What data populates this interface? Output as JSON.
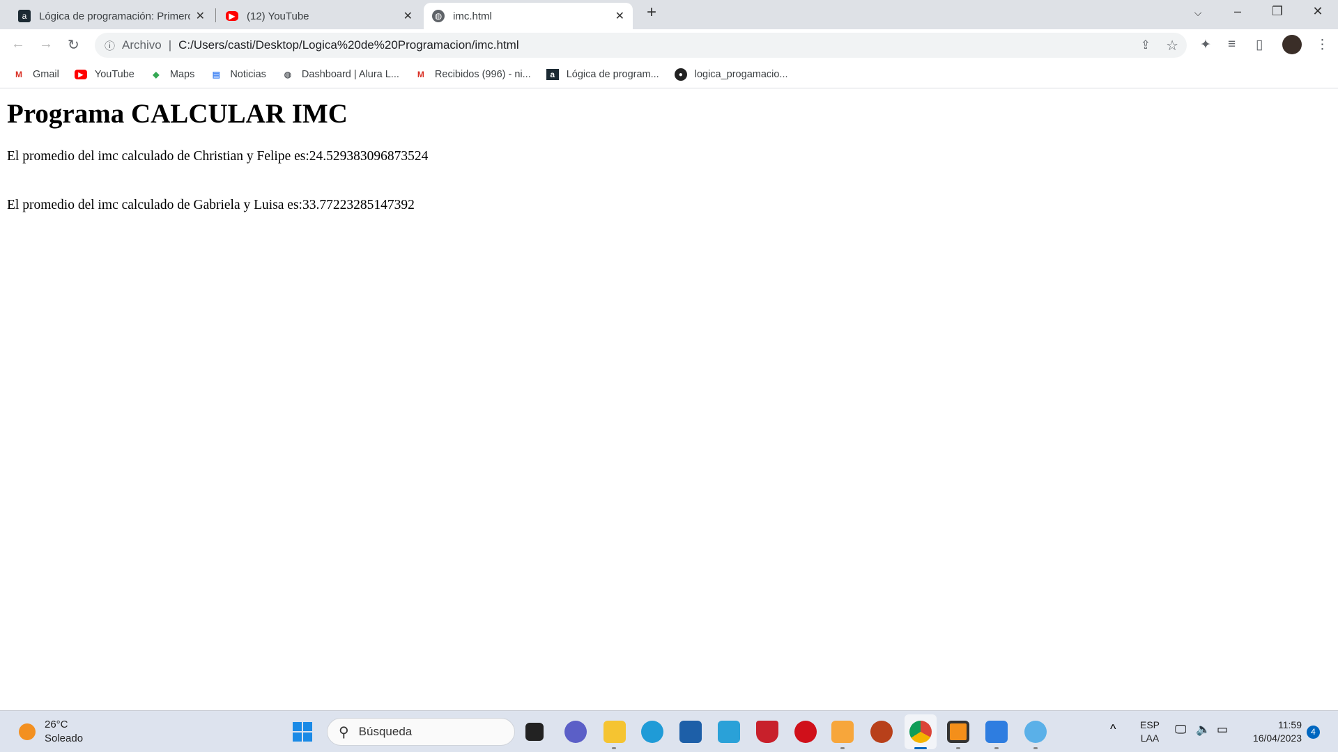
{
  "browser": {
    "tabs": [
      {
        "title": "Lógica de programación: Primeros pasos",
        "icon": "alura-icon",
        "active": false
      },
      {
        "title": "(12) YouTube",
        "icon": "youtube-icon",
        "active": false
      },
      {
        "title": "imc.html",
        "icon": "globe-icon",
        "active": true
      }
    ],
    "new_tab": "+",
    "address": {
      "scheme_label": "Archivo",
      "url": "C:/Users/casti/Desktop/Logica%20de%20Programacion/imc.html"
    },
    "bookmarks": [
      {
        "label": "Gmail",
        "icon": "gmail-icon"
      },
      {
        "label": "YouTube",
        "icon": "youtube-icon"
      },
      {
        "label": "Maps",
        "icon": "maps-icon"
      },
      {
        "label": "Noticias",
        "icon": "news-icon"
      },
      {
        "label": "Dashboard | Alura L...",
        "icon": "globe-icon"
      },
      {
        "label": "Recibidos (996) - ni...",
        "icon": "gmail-icon"
      },
      {
        "label": "Lógica de program...",
        "icon": "alura-icon"
      },
      {
        "label": "logica_progamacio...",
        "icon": "github-icon"
      }
    ]
  },
  "page": {
    "heading": "Programa CALCULAR IMC",
    "lines": [
      "El promedio del imc calculado de Christian y Felipe es:24.529383096873524",
      "El promedio del imc calculado de Gabriela y Luisa es:33.77223285147392"
    ]
  },
  "taskbar": {
    "weather": {
      "temp": "26°C",
      "condition": "Soleado"
    },
    "search_placeholder": "Búsqueda",
    "lang": {
      "code": "ESP",
      "layout": "LAA"
    },
    "time": "11:59",
    "date": "16/04/2023",
    "notifications": "4"
  }
}
